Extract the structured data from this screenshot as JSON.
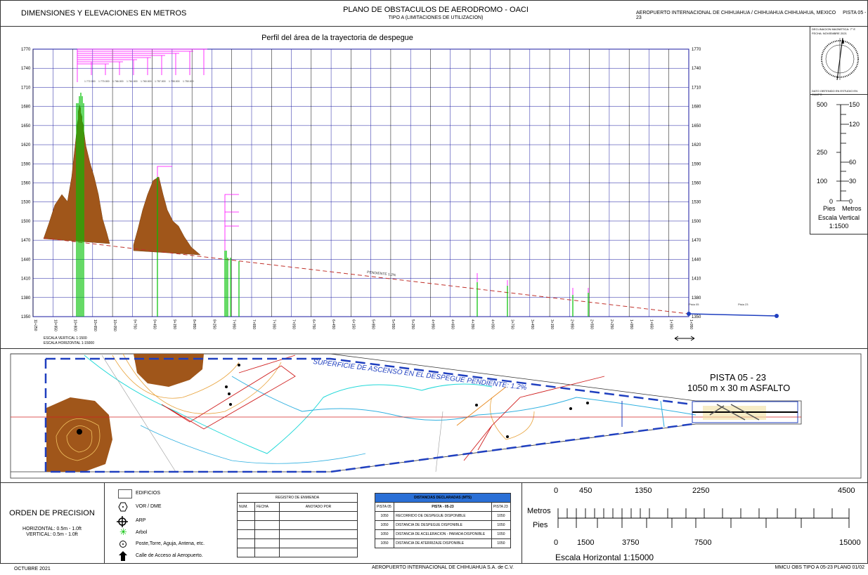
{
  "header": {
    "left": "DIMENSIONES Y ELEVACIONES EN METROS",
    "center_title": "PLANO DE OBSTACULOS DE AERODROMO - OACI",
    "center_sub": "TIPO A (LIMITACIONES DE UTILIZACION)",
    "right": "AEROPUERTO INTERNACIONAL DE CHIHUAHUA / CHIHUAHUA CHIHUAHUA, MEXICO",
    "right_code": "PISTA 05 - 23"
  },
  "profile": {
    "title": "Perfil del área de la trayectoria de despegue",
    "y_ticks": [
      "1770",
      "1740",
      "1710",
      "1680",
      "1650",
      "1620",
      "1590",
      "1560",
      "1530",
      "1500",
      "1470",
      "1440",
      "1410",
      "1380",
      "1350"
    ],
    "x_ticks": [
      "11+250",
      "10+950",
      "10+800",
      "10+650",
      "10+050",
      "9+750",
      "9+450",
      "9+150",
      "8+850",
      "8+250",
      "7+950",
      "7+650",
      "7+350",
      "7+050",
      "6+750",
      "6+450",
      "6+150",
      "5+850",
      "5+550",
      "5+250",
      "4+950",
      "4+650",
      "4+350",
      "4+050",
      "3+750",
      "3+450",
      "3+150",
      "2+850",
      "2+550",
      "2+250",
      "1+950",
      "1+650",
      "1+350",
      "1+050"
    ],
    "scale_vertical": "ESCALA VERTICAL   1:1500",
    "scale_horizontal": "ESCALA HORIZONTAL 1:15000",
    "slope_label": "PENDIENTE 1.2%",
    "obstacle_labels": [
      "1 772.000",
      "1 770.000",
      "1 766.000",
      "1 764.000",
      "1 760.000",
      "1 757.000",
      "1 755.000",
      "1 750.000"
    ],
    "runway_labels": [
      "Pista 05",
      "Pista 23"
    ]
  },
  "compass": {
    "line1": "DECLINACION MAGNETICA: 7° E",
    "line2": "FECHA: NOVIEMBRE 2021",
    "foot": "DATO OBTENIDO EN ESTUDIO EN CAMPO"
  },
  "vscale": {
    "left_ticks": [
      "500",
      "250",
      "100",
      "0"
    ],
    "right_ticks": [
      "150",
      "120",
      "60",
      "30",
      "0"
    ],
    "unit_left": "Pies",
    "unit_right": "Metros",
    "title": "Escala Vertical",
    "ratio": "1:1500"
  },
  "plan": {
    "surface_label": "SUPERFICIE DE ASCENSO EN EL DESPEGUE   PENDIENTE: 1.2%",
    "runway_title": "PISTA 05 - 23",
    "runway_dims": "1050 m x 30 m ASFALTO"
  },
  "precision": {
    "title": "ORDEN DE PRECISION",
    "h": "HORIZONTAL: 0.5m - 1.0ft",
    "v": "VERTICAL: 0.5m - 1.0ft"
  },
  "legend": {
    "items": [
      "EDIFICIOS",
      "VOR / DME",
      "ARP",
      "Arbol",
      "Poste,Torre, Aguja, Antena, etc.",
      "Calle de Acceso al Aeropuerto."
    ]
  },
  "registry": {
    "title": "REGISTRO DE ENMIENDA",
    "cols": [
      "NUM.",
      "FECHA",
      "ANOTADO POR"
    ]
  },
  "distances": {
    "title": "DISTANCIAS DECLARADAS (MTS)",
    "head": [
      "PISTA 05",
      "PISTA - 05-23",
      "PISTA 23"
    ],
    "rows": [
      [
        "1050",
        "RECORRIDO DE DESPEGUE DISPONIBLE",
        "1050"
      ],
      [
        "1050",
        "DISTANCIA DE DESPEGUE DISPONIBLE",
        "1050"
      ],
      [
        "1050",
        "DISTANCIA DE ACELERACION - PARADA DISPONIBLE",
        "1050"
      ],
      [
        "1050",
        "DISTANCIA DE ATERRIZAJE DISPONIBLE",
        "1050"
      ]
    ]
  },
  "hscale": {
    "top_values": [
      "0",
      "450",
      "1350",
      "2250",
      "4500"
    ],
    "bottom_values": [
      "0",
      "1500",
      "3750",
      "7500",
      "15000"
    ],
    "label_top": "Metros",
    "label_bottom": "Pies",
    "title": "Escala Horizontal 1:15000"
  },
  "footer": {
    "left": "OCTUBRE 2021",
    "center": "AEROPUERTO INTERNACIONAL DE CHIHUAHUA S.A.  de  C.V.",
    "right": "MMCU OBS TIPO A 05-23 PLANO 01/02"
  },
  "colors": {
    "terrain": "#a0561a",
    "grid": "#1a1aa0",
    "obstacle": "#ff00ff",
    "tree": "#00c000",
    "dash": "#c0302a",
    "blue": "#1f3fbf"
  }
}
